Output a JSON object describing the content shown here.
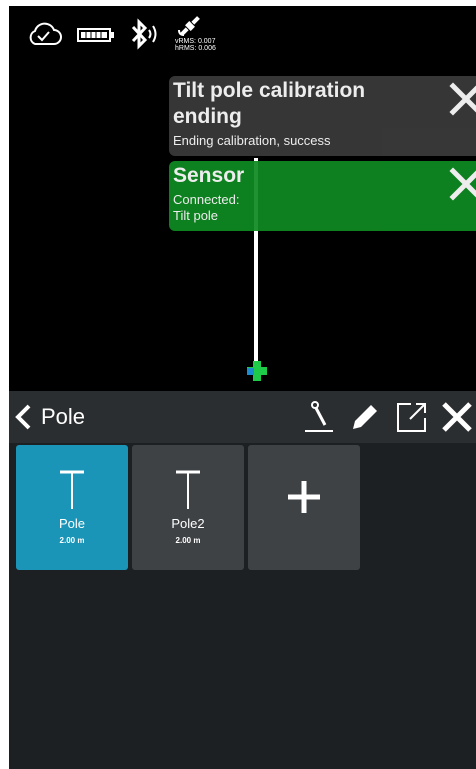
{
  "status": {
    "vrms_text": "vRMS: 0.007",
    "hrms_text": "hRMS: 0.006",
    "icons": [
      "cloud-icon",
      "battery-icon",
      "bluetooth-icon",
      "satellite-icon"
    ]
  },
  "notifications": [
    {
      "title_line1": "Tilt pole calibration",
      "title_line2": "ending",
      "message": "Ending calibration, success",
      "color": "#3b3b3b"
    },
    {
      "title": "Sensor",
      "message_line1": "Connected:",
      "message_line2": "Tilt pole",
      "color": "#0f8a22"
    }
  ],
  "panel": {
    "title": "Pole",
    "poles": [
      {
        "name": "Pole",
        "height": "2.00 m",
        "selected": true
      },
      {
        "name": "Pole2",
        "height": "2.00 m",
        "selected": false
      }
    ],
    "add_label": "+"
  },
  "colors": {
    "selected_card": "#1a95b8",
    "card": "#3f4244",
    "marker": "#1ecc4a",
    "marker_accent": "#1a8ccf"
  }
}
